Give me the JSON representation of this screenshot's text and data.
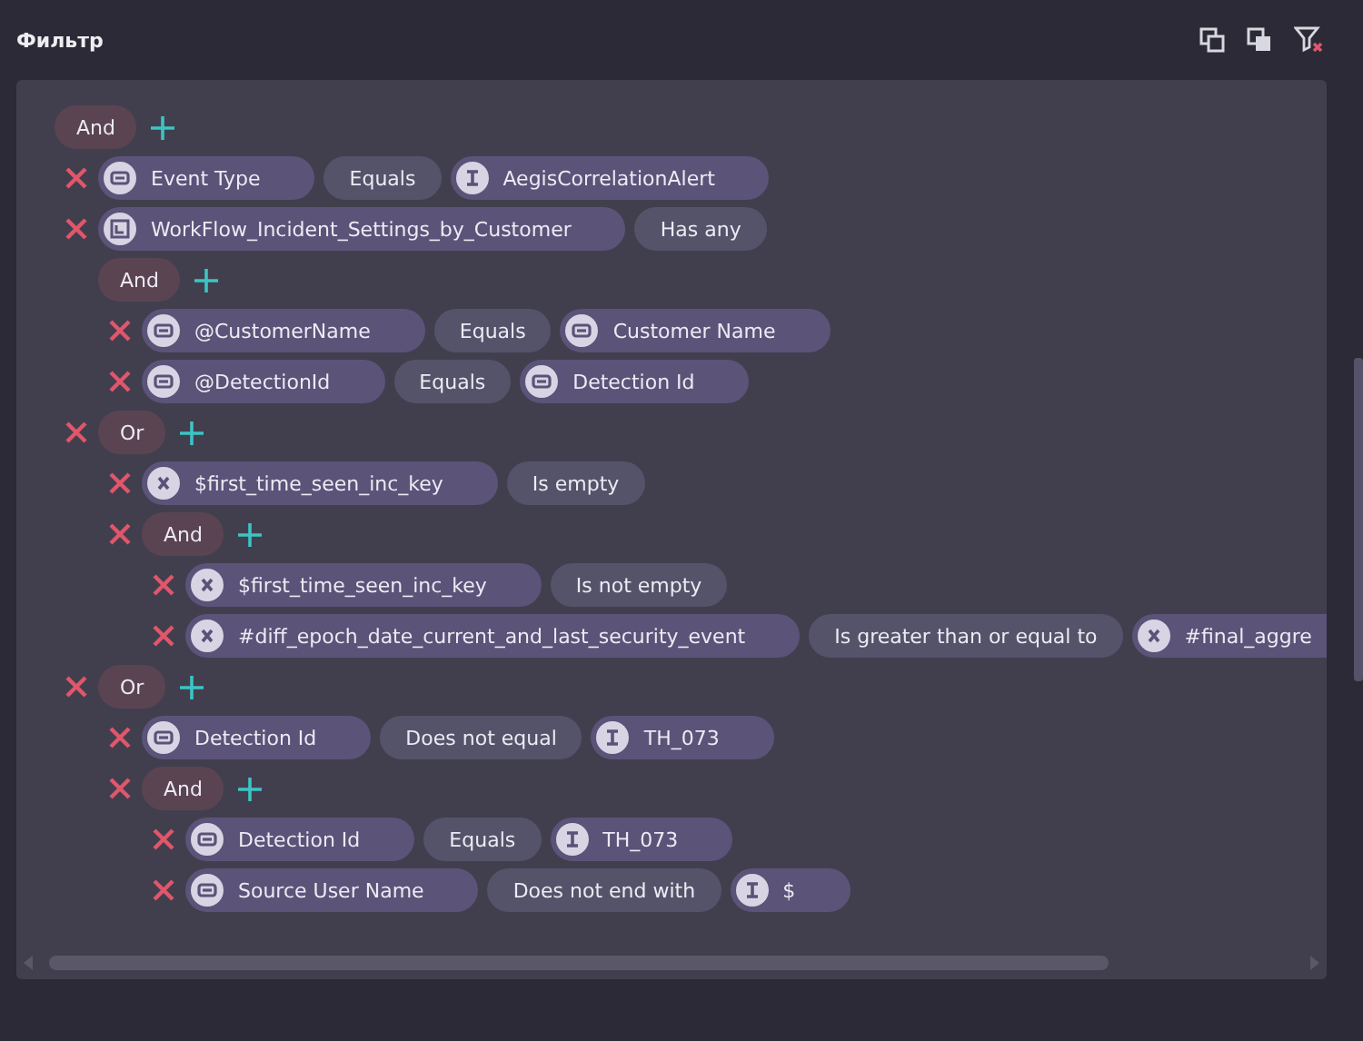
{
  "header": {
    "title": "Фильтр"
  },
  "filter": {
    "operator": "And",
    "children": [
      {
        "kind": "condition",
        "field": {
          "kind": "field",
          "label": "Event Type"
        },
        "operator": "Equals",
        "value": {
          "kind": "text",
          "label": "AegisCorrelationAlert"
        }
      },
      {
        "kind": "condition",
        "field": {
          "kind": "list",
          "label": "WorkFlow_Incident_Settings_by_Customer"
        },
        "operator": "Has any",
        "subgroup": {
          "operator": "And",
          "children": [
            {
              "kind": "condition",
              "field": {
                "kind": "field",
                "label": "@CustomerName"
              },
              "operator": "Equals",
              "value": {
                "kind": "field",
                "label": "Customer Name"
              }
            },
            {
              "kind": "condition",
              "field": {
                "kind": "field",
                "label": "@DetectionId"
              },
              "operator": "Equals",
              "value": {
                "kind": "field",
                "label": "Detection Id"
              }
            }
          ]
        }
      },
      {
        "kind": "group",
        "operator": "Or",
        "children": [
          {
            "kind": "condition",
            "field": {
              "kind": "variable",
              "label": "$first_time_seen_inc_key"
            },
            "operator": "Is empty"
          },
          {
            "kind": "group",
            "operator": "And",
            "children": [
              {
                "kind": "condition",
                "field": {
                  "kind": "variable",
                  "label": "$first_time_seen_inc_key"
                },
                "operator": "Is not empty"
              },
              {
                "kind": "condition",
                "field": {
                  "kind": "variable",
                  "label": "#diff_epoch_date_current_and_last_security_event"
                },
                "operator": "Is greater than or equal to",
                "value": {
                  "kind": "variable",
                  "label": "#final_aggre"
                }
              }
            ]
          }
        ]
      },
      {
        "kind": "group",
        "operator": "Or",
        "children": [
          {
            "kind": "condition",
            "field": {
              "kind": "field",
              "label": "Detection Id"
            },
            "operator": "Does not equal",
            "value": {
              "kind": "text",
              "label": "TH_073"
            }
          },
          {
            "kind": "group",
            "operator": "And",
            "children": [
              {
                "kind": "condition",
                "field": {
                  "kind": "field",
                  "label": "Detection Id"
                },
                "operator": "Equals",
                "value": {
                  "kind": "text",
                  "label": "TH_073"
                }
              },
              {
                "kind": "condition",
                "field": {
                  "kind": "field",
                  "label": "Source User Name"
                },
                "operator": "Does not end with",
                "value": {
                  "kind": "text",
                  "label": "$"
                }
              }
            ]
          }
        ]
      }
    ]
  }
}
